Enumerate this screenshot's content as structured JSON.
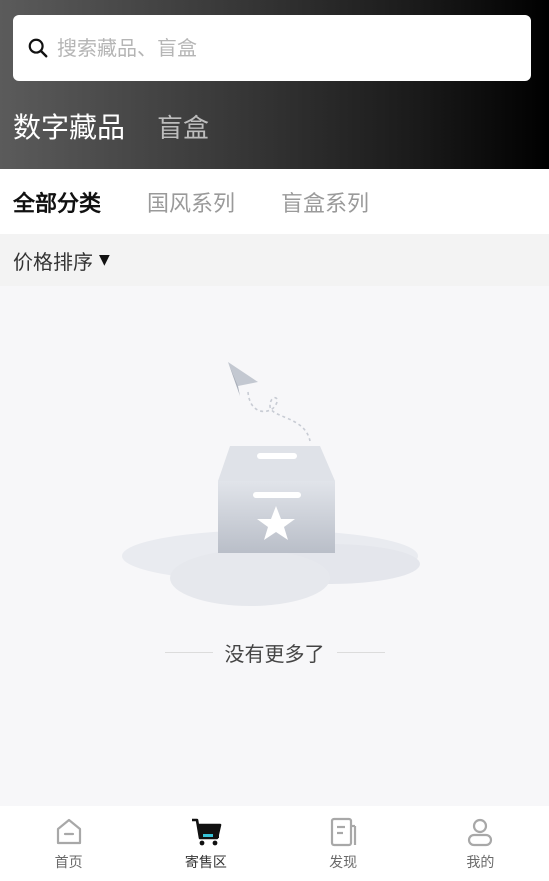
{
  "search": {
    "placeholder": "搜索藏品、盲盒",
    "icon": "search-icon"
  },
  "main_tabs": [
    {
      "label": "数字藏品",
      "active": true
    },
    {
      "label": "盲盒",
      "active": false
    }
  ],
  "category_tabs": [
    {
      "label": "全部分类",
      "active": true
    },
    {
      "label": "国风系列",
      "active": false
    },
    {
      "label": "盲盒系列",
      "active": false
    }
  ],
  "sort": {
    "label": "价格排序",
    "icon": "caret-down-icon"
  },
  "empty": {
    "message": "没有更多了",
    "icon": "empty-box-illustration"
  },
  "bottom_nav": [
    {
      "label": "首页",
      "icon": "home-icon",
      "active": false
    },
    {
      "label": "寄售区",
      "icon": "cart-icon",
      "active": true
    },
    {
      "label": "发现",
      "icon": "discover-icon",
      "active": false
    },
    {
      "label": "我的",
      "icon": "profile-icon",
      "active": false
    }
  ],
  "colors": {
    "accent": "#36c3d8",
    "header_dark": "#000000",
    "header_light": "#5b5b5b"
  }
}
